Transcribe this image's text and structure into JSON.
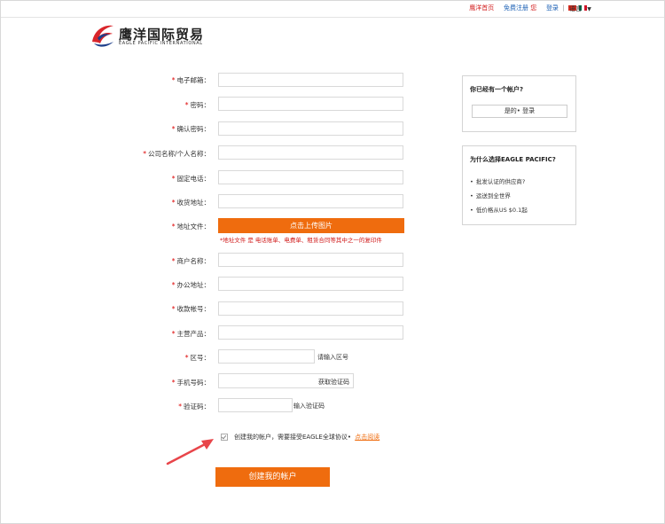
{
  "topbar": {
    "home": "鹰洋首页",
    "register": "免费注册",
    "you": "您",
    "login": "登录",
    "divider": "|",
    "language": "语言"
  },
  "logo": {
    "cn": "鹰洋国际贸易",
    "en": "EAGLE PACIFIC INTERNATIONAL"
  },
  "form": {
    "email": "电子邮箱：",
    "password": "密码：",
    "confirm": "确认密码：",
    "company": "公司名称/个人名称：",
    "phone": "固定电话：",
    "delivery": "收货地址：",
    "addressfile": "地址文件：",
    "upload_btn": "点击上传图片",
    "upload_note": "*地址文件 是 电话账单、电费单、租赁合同等其中之一的复印件",
    "merchant": "商户名称：",
    "office": "办公地址：",
    "account": "收款帐号：",
    "product": "主营产品：",
    "area": "区号：",
    "area_hint": "请输入区号",
    "mobile": "手机号码：",
    "get_code": "获取验证码",
    "code": "验证码：",
    "code_hint": "输入验证码",
    "agree_text": "创建我的帐户，需要接受EAGLE全球协议• ",
    "agree_link": "点击阅读",
    "create_btn": "创建我的帐户"
  },
  "sidebar": {
    "account_title": "你已经有一个帐户?",
    "login_btn": "是的• 登录",
    "why_title": "为什么选择EAGLE PACIFIC?",
    "reasons": [
      "批发认证的供应商?",
      "运送到全世界",
      "低价格从US $0.1起"
    ]
  },
  "colors": {
    "accent": "#ef6c0e",
    "required": "#d00000",
    "link_blue": "#1a5fb4",
    "arrow": "#e8454a"
  }
}
